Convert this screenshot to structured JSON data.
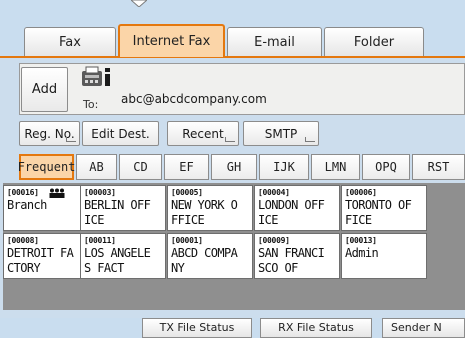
{
  "tabs": [
    {
      "label": "Fax",
      "active": false
    },
    {
      "label": "Internet Fax",
      "active": true
    },
    {
      "label": "E-mail",
      "active": false
    },
    {
      "label": "Folder",
      "active": false
    }
  ],
  "destination": {
    "add_label": "Add",
    "to_label": "To:",
    "address": "abc@abcdcompany.com",
    "device_icon": "fax-machine-info-icon"
  },
  "actions": {
    "reg_no": "Reg. No.",
    "edit_dest": "Edit Dest.",
    "recent": "Recent",
    "smtp": "SMTP"
  },
  "index": [
    "Frequent",
    "AB",
    "CD",
    "EF",
    "GH",
    "IJK",
    "LMN",
    "OPQ",
    "RST"
  ],
  "entries": [
    {
      "num": "[00016]",
      "group": "grp",
      "line1": "Branch",
      "line2": ""
    },
    {
      "num": "[00003]",
      "group": "",
      "line1": "BERLIN OFF",
      "line2": "ICE"
    },
    {
      "num": "[00005]",
      "group": "",
      "line1": "NEW YORK O",
      "line2": "FFICE"
    },
    {
      "num": "[00004]",
      "group": "",
      "line1": "LONDON OFF",
      "line2": "ICE"
    },
    {
      "num": "[00006]",
      "group": "",
      "line1": "TORONTO OF",
      "line2": "FICE"
    },
    {
      "num": "[00008]",
      "group": "",
      "line1": "DETROIT FA",
      "line2": "CTORY"
    },
    {
      "num": "[00011]",
      "group": "",
      "line1": "LOS ANGELE",
      "line2": "S FACT"
    },
    {
      "num": "[00001]",
      "group": "",
      "line1": "ABCD COMPA",
      "line2": "NY"
    },
    {
      "num": "[00009]",
      "group": "",
      "line1": "SAN FRANCI",
      "line2": "SCO OF"
    },
    {
      "num": "[00013]",
      "group": "",
      "line1": "Admin",
      "line2": ""
    }
  ],
  "bottom": {
    "tx_status": "TX File Status",
    "rx_status": "RX File Status",
    "sender": "Sender N"
  },
  "colors": {
    "accent": "#e4780f",
    "active_fill": "#fbd5a8",
    "background": "#c9ddef"
  }
}
